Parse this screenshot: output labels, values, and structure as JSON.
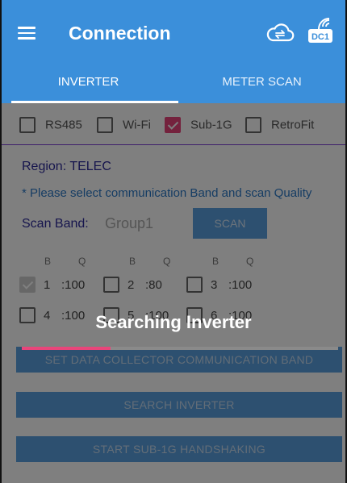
{
  "appbar": {
    "title": "Connection",
    "menu_icon": "hamburger-menu-icon",
    "cloud_icon": "cloud-sync-icon",
    "device_icon": "data-collector-wifi-icon",
    "device_badge": "DC1"
  },
  "tabs": [
    {
      "label": "INVERTER",
      "active": true
    },
    {
      "label": "METER SCAN",
      "active": false
    }
  ],
  "colors": {
    "primary": "#3b8fda",
    "accent": "#e8457a",
    "label_dark": "#2d2a9a",
    "label_blue": "#2d7ac8"
  },
  "communication": [
    {
      "label": "RS485",
      "checked": false
    },
    {
      "label": "Wi-Fi",
      "checked": false
    },
    {
      "label": "Sub-1G",
      "checked": true
    },
    {
      "label": "RetroFit",
      "checked": false
    }
  ],
  "region": {
    "label": "Region:",
    "value": "TELEC"
  },
  "hint": "* Please select communication Band and scan Quality",
  "scan_band": {
    "label": "Scan Band:",
    "value": "Group1",
    "button": "SCAN"
  },
  "band_headers": {
    "b": "B",
    "q": "Q"
  },
  "band_options": [
    {
      "band": "1",
      "quality": ":100",
      "checked": true
    },
    {
      "band": "2",
      "quality": ":80",
      "checked": false
    },
    {
      "band": "3",
      "quality": ":100",
      "checked": false
    },
    {
      "band": "4",
      "quality": ":100",
      "checked": false
    },
    {
      "band": "5",
      "quality": ":100",
      "checked": false
    },
    {
      "band": "6",
      "quality": ":100",
      "checked": false
    }
  ],
  "buttons": {
    "set_band": "SET DATA COLLECTOR COMMUNICATION BAND",
    "search_inverter": "SEARCH INVERTER",
    "start_handshake": "START SUB-1G HANDSHAKING"
  },
  "progress": {
    "fraction": 0.28
  },
  "loading": {
    "text": "Searching Inverter"
  }
}
